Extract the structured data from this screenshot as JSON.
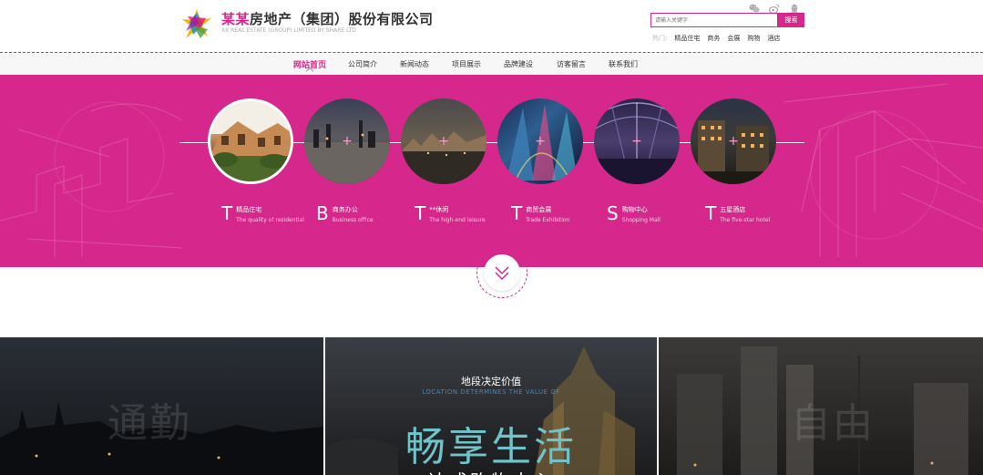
{
  "header": {
    "brand_highlight": "某某",
    "brand_rest": "房地产（集团）股份有限公司",
    "brand_sub": "XX REAL ESTATE (GROUP) LIMITED BY SHARE LTD",
    "search_placeholder": "请输入关键字",
    "search_button": "搜索",
    "hot_label": "热门:",
    "hot_tags": [
      "精品住宅",
      "商务",
      "会展",
      "购物",
      "酒店"
    ],
    "social_icons": [
      "wechat-icon",
      "weibo-icon",
      "qq-icon"
    ]
  },
  "nav": {
    "items": [
      "网站首页",
      "公司简介",
      "新闻动态",
      "项目展示",
      "品牌建设",
      "访客留言",
      "联系我们"
    ],
    "active_index": 0
  },
  "banner": {
    "items": [
      {
        "letter": "T",
        "cn": "精品住宅",
        "en": "The quality of residential"
      },
      {
        "letter": "B",
        "cn": "商务办公",
        "en": "Business office"
      },
      {
        "letter": "T",
        "cn": "**休闲",
        "en": "The high-end leisure"
      },
      {
        "letter": "T",
        "cn": "商贸会展",
        "en": "Trade Exhibition"
      },
      {
        "letter": "S",
        "cn": "购物中心",
        "en": "Shopping Mall"
      },
      {
        "letter": "T",
        "cn": "五星酒店",
        "en": "The five-star hotel"
      }
    ],
    "plus_symbol": "+"
  },
  "panels": {
    "left_ghost": "通勤",
    "mid_title": "地段决定价值",
    "mid_sub": "LOCATION DETERMINES THE VALUE OF",
    "mid_big": "畅享生活",
    "mid_cut": "达成购物中心",
    "right_ghost": "自由"
  },
  "colors": {
    "accent": "#d6288c",
    "teal": "#6fc3c9"
  }
}
